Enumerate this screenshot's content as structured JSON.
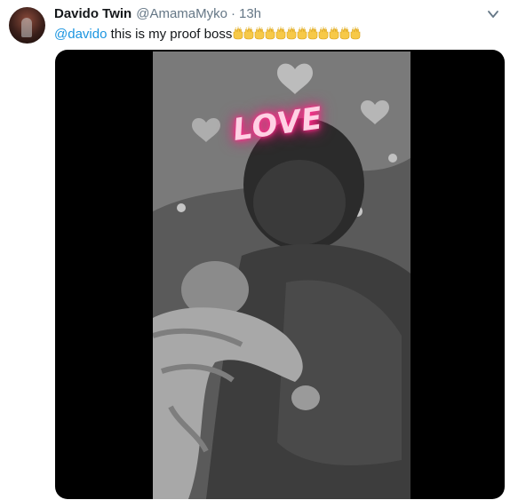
{
  "author": {
    "display_name": "Davido Twin",
    "handle": "@AmamaMyko",
    "separator": "·",
    "time": "13h"
  },
  "tweet": {
    "mention": "@davido",
    "text": " this is my proof boss",
    "emoji_name": "raising-hands",
    "emoji_count": 12
  },
  "media": {
    "overlay_text": "LOVE"
  },
  "colors": {
    "link": "#1b95e0",
    "muted": "#657786",
    "text": "#14171a",
    "neon": "#ff2d8a"
  }
}
